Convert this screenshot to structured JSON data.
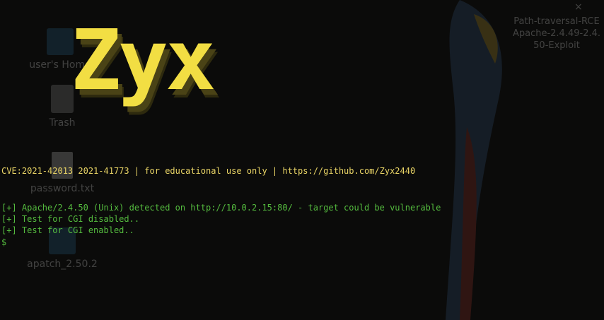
{
  "colors": {
    "background": "#0b0b0a",
    "logo": "#f2de43",
    "banner_text": "#ead566",
    "output_text": "#55bc3f"
  },
  "desktop": {
    "icons": [
      {
        "label": "user's Home",
        "icon": "folder-home-icon"
      },
      {
        "label": "Trash",
        "icon": "trash-icon"
      },
      {
        "label": "password.txt",
        "icon": "text-file-icon"
      },
      {
        "label": "apatch_2.50.2",
        "icon": "folder-icon"
      }
    ],
    "file_label": "Path-traversal-RCE\nApache-2.4.49-2.4.\n50-Exploit",
    "close_glyph": "×"
  },
  "terminal": {
    "logo_text": "Zyx",
    "banner_line": "CVE:2021-42013 2021-41773 | for educational use only | https://github.com/Zyx2440",
    "output_lines": [
      "[+] Apache/2.4.50 (Unix) detected on http://10.0.2.15:80/ - target could be vulnerable",
      "[+] Test for CGI disabled..",
      "[+] Test for CGI enabled.."
    ],
    "prompt": "$"
  }
}
